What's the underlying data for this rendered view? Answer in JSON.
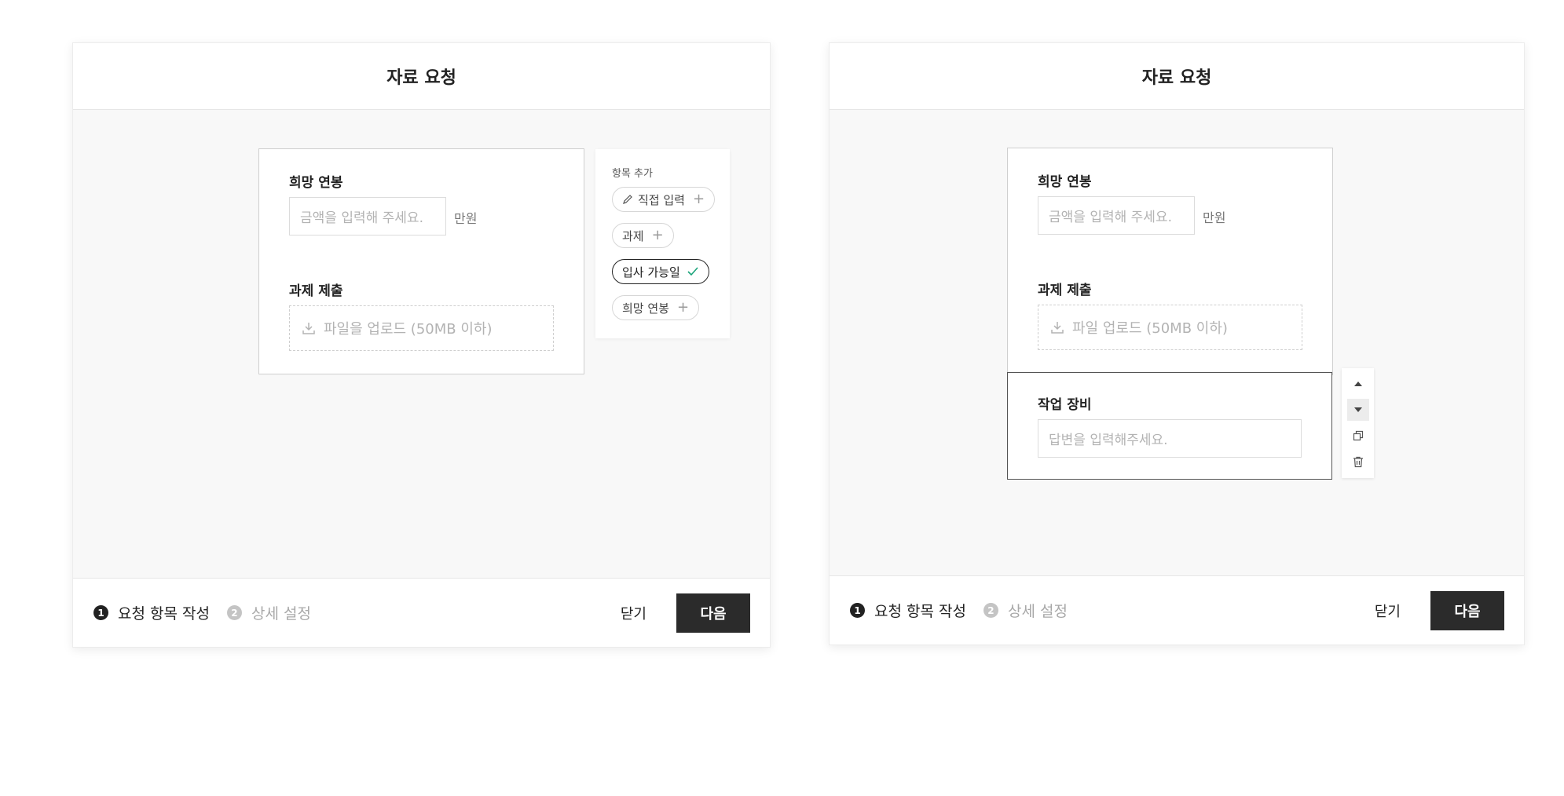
{
  "left_modal": {
    "title": "자료 요청",
    "fields": {
      "salary_label": "희망 연봉",
      "salary_placeholder": "금액을 입력해 주세요.",
      "salary_unit": "만원",
      "assignment_label": "과제 제출",
      "upload_text": "파일을 업로드 (50MB 이하)"
    },
    "add_panel": {
      "title": "항목 추가",
      "chips": [
        {
          "label": "직접 입력",
          "icon": "plus-icon"
        },
        {
          "label": "과제",
          "icon": "plus-icon"
        },
        {
          "label": "입사 가능일",
          "icon": "check-icon",
          "selected": true
        },
        {
          "label": "희망 연봉",
          "icon": "plus-icon"
        }
      ],
      "check_color": "#1aa37a"
    },
    "footer": {
      "steps": [
        {
          "num": "1",
          "label": "요청 항목 작성",
          "active": true
        },
        {
          "num": "2",
          "label": "상세 설정",
          "active": false
        }
      ],
      "close_label": "닫기",
      "next_label": "다음"
    }
  },
  "right_modal": {
    "title": "자료 요청",
    "fields": {
      "salary_label": "희망 연봉",
      "salary_placeholder": "금액을 입력해 주세요.",
      "salary_unit": "만원",
      "assignment_label": "과제 제출",
      "upload_text": "파일 업로드 (50MB 이하)",
      "equipment_label": "작업 장비",
      "equipment_placeholder": "답변을 입력해주세요."
    },
    "side_tools": [
      "move-up-icon",
      "move-down-icon",
      "duplicate-icon",
      "delete-icon"
    ],
    "footer": {
      "steps": [
        {
          "num": "1",
          "label": "요청 항목 작성",
          "active": true
        },
        {
          "num": "2",
          "label": "상세 설정",
          "active": false
        }
      ],
      "close_label": "닫기",
      "next_label": "다음"
    }
  },
  "colors": {
    "primary_button": "#2b2b2b",
    "background": "#f8f8f8"
  }
}
